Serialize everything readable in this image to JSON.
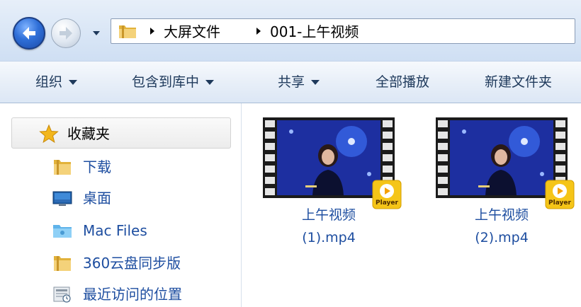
{
  "address_bar": {
    "breadcrumbs": [
      "大屏文件",
      "001-上午视频"
    ]
  },
  "toolbar": {
    "items": [
      "组织",
      "包含到库中",
      "共享",
      "全部播放",
      "新建文件夹"
    ]
  },
  "nav_pane": {
    "favorites_label": "收藏夹",
    "items": [
      {
        "label": "下载",
        "icon": "folder-icon"
      },
      {
        "label": "桌面",
        "icon": "desktop-icon"
      },
      {
        "label": "Mac Files",
        "icon": "mac-folder-icon"
      },
      {
        "label": "360云盘同步版",
        "icon": "folder-icon"
      },
      {
        "label": "最近访问的位置",
        "icon": "recent-places-icon"
      }
    ]
  },
  "files": [
    {
      "name_line1": "上午视频",
      "name_line2": "(1).mp4",
      "badge": "Player"
    },
    {
      "name_line1": "上午视频",
      "name_line2": "(2).mp4",
      "badge": "Player"
    }
  ],
  "colors": {
    "link_blue": "#1e4ea0",
    "toolbar_text": "#1e395b",
    "badge_yellow": "#f5c518"
  }
}
